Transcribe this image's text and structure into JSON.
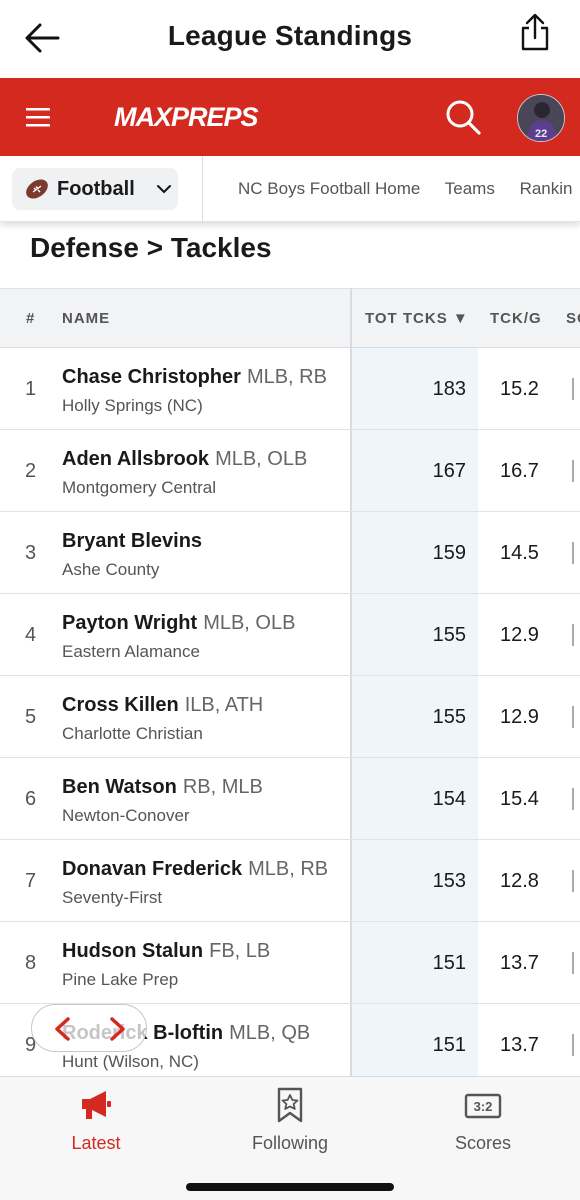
{
  "header": {
    "title": "League Standings"
  },
  "brand": {
    "logo_text": "MAXPREPS",
    "color": "#d4291f"
  },
  "sport_selector": {
    "label": "Football"
  },
  "subnav": [
    "NC Boys Football Home",
    "Teams",
    "Rankin"
  ],
  "section_title": "Defense > Tackles",
  "table": {
    "columns": [
      "#",
      "NAME",
      "TOT TCKS ▼",
      "TCK/G",
      "SO"
    ],
    "rows": [
      {
        "rank": "1",
        "name": "Chase Christopher",
        "pos": "MLB, RB",
        "school": "Holly Springs (NC)",
        "tot": "183",
        "tpg": "15.2"
      },
      {
        "rank": "2",
        "name": "Aden Allsbrook",
        "pos": "MLB, OLB",
        "school": "Montgomery Central",
        "tot": "167",
        "tpg": "16.7"
      },
      {
        "rank": "3",
        "name": "Bryant Blevins",
        "pos": "",
        "school": "Ashe County",
        "tot": "159",
        "tpg": "14.5"
      },
      {
        "rank": "4",
        "name": "Payton Wright",
        "pos": "MLB, OLB",
        "school": "Eastern Alamance",
        "tot": "155",
        "tpg": "12.9"
      },
      {
        "rank": "5",
        "name": "Cross Killen",
        "pos": "ILB, ATH",
        "school": "Charlotte Christian",
        "tot": "155",
        "tpg": "12.9"
      },
      {
        "rank": "6",
        "name": "Ben Watson",
        "pos": "RB, MLB",
        "school": "Newton-Conover",
        "tot": "154",
        "tpg": "15.4"
      },
      {
        "rank": "7",
        "name": "Donavan Frederick",
        "pos": "MLB, RB",
        "school": "Seventy-First",
        "tot": "153",
        "tpg": "12.8"
      },
      {
        "rank": "8",
        "name": "Hudson Stalun",
        "pos": "FB, LB",
        "school": "Pine Lake Prep",
        "tot": "151",
        "tpg": "13.7"
      },
      {
        "rank": "9",
        "name": "Roderick B-loftin",
        "pos": "MLB, QB",
        "school": "Hunt (Wilson, NC)",
        "tot": "151",
        "tpg": "13.7"
      }
    ]
  },
  "tabbar": {
    "tabs": [
      {
        "label": "Latest",
        "icon": "megaphone-icon",
        "active": true
      },
      {
        "label": "Following",
        "icon": "bookmark-star-icon",
        "active": false
      },
      {
        "label": "Scores",
        "icon": "scoreboard-icon",
        "active": false
      }
    ],
    "scoreboard_text": "3:2"
  }
}
